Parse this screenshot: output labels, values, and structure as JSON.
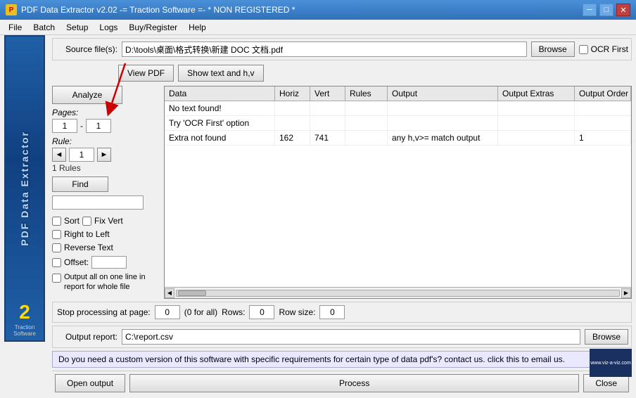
{
  "titlebar": {
    "icon_text": "P",
    "title": "PDF Data Extractor v2.02   -= Traction Software =-  * NON REGISTERED *",
    "minimize": "─",
    "maximize": "□",
    "close": "✕"
  },
  "menu": {
    "items": [
      "File",
      "Batch",
      "Setup",
      "Logs",
      "Buy/Register",
      "Help"
    ]
  },
  "source": {
    "label": "Source file(s):",
    "value": "D:\\tools\\桌面\\格式转换\\新建 DOC 文档.pdf",
    "browse_label": "Browse",
    "ocr_label": "OCR First"
  },
  "view_buttons": {
    "view_pdf": "View PDF",
    "show_text": "Show text and h,v"
  },
  "controls": {
    "analyze": "Analyze",
    "pages_label": "Pages:",
    "page_from": "1",
    "page_to": "1",
    "rule_label": "Rule:",
    "rule_value": "1",
    "rules_count": "1 Rules",
    "find": "Find",
    "sort_label": "Sort",
    "fix_vert_label": "Fix Vert",
    "right_to_left": "Right to Left",
    "reverse_text": "Reverse Text",
    "offset_label": "Offset:",
    "output_all_label": "Output all on one line in report for whole file"
  },
  "table": {
    "headers": [
      "Data",
      "Horiz",
      "Vert",
      "Rules",
      "Output",
      "Output Extras",
      "Output Order"
    ],
    "rows": [
      {
        "data": "No text found!",
        "horiz": "",
        "vert": "",
        "rules": "",
        "output": "",
        "extras": "",
        "order": ""
      },
      {
        "data": "Try 'OCR First' option",
        "horiz": "",
        "vert": "",
        "rules": "",
        "output": "",
        "extras": "",
        "order": ""
      },
      {
        "data": "Extra not found",
        "horiz": "162",
        "vert": "741",
        "rules": "",
        "output": "any h,v>= match output",
        "extras": "",
        "order": "1"
      }
    ]
  },
  "processing": {
    "stop_label": "Stop processing at page:",
    "stop_value": "0",
    "for_all": "(0 for all)",
    "rows_label": "Rows:",
    "rows_value": "0",
    "row_size_label": "Row size:",
    "row_size_value": "0"
  },
  "output": {
    "label": "Output report:",
    "value": "C:\\report.csv",
    "browse_label": "Browse"
  },
  "info": {
    "text": "Do you need a custom version of this software with specific requirements for certain type of data pdf's? contact us. click this to email us."
  },
  "bottom": {
    "open_output": "Open output",
    "process": "Process",
    "close": "Close"
  },
  "sidebar": {
    "text": "PDF Data Extractor",
    "logo": "2",
    "brand_line1": "Traction",
    "brand_line2": "Software"
  },
  "watermark": {
    "url": "www.viz-a-viz.com"
  }
}
